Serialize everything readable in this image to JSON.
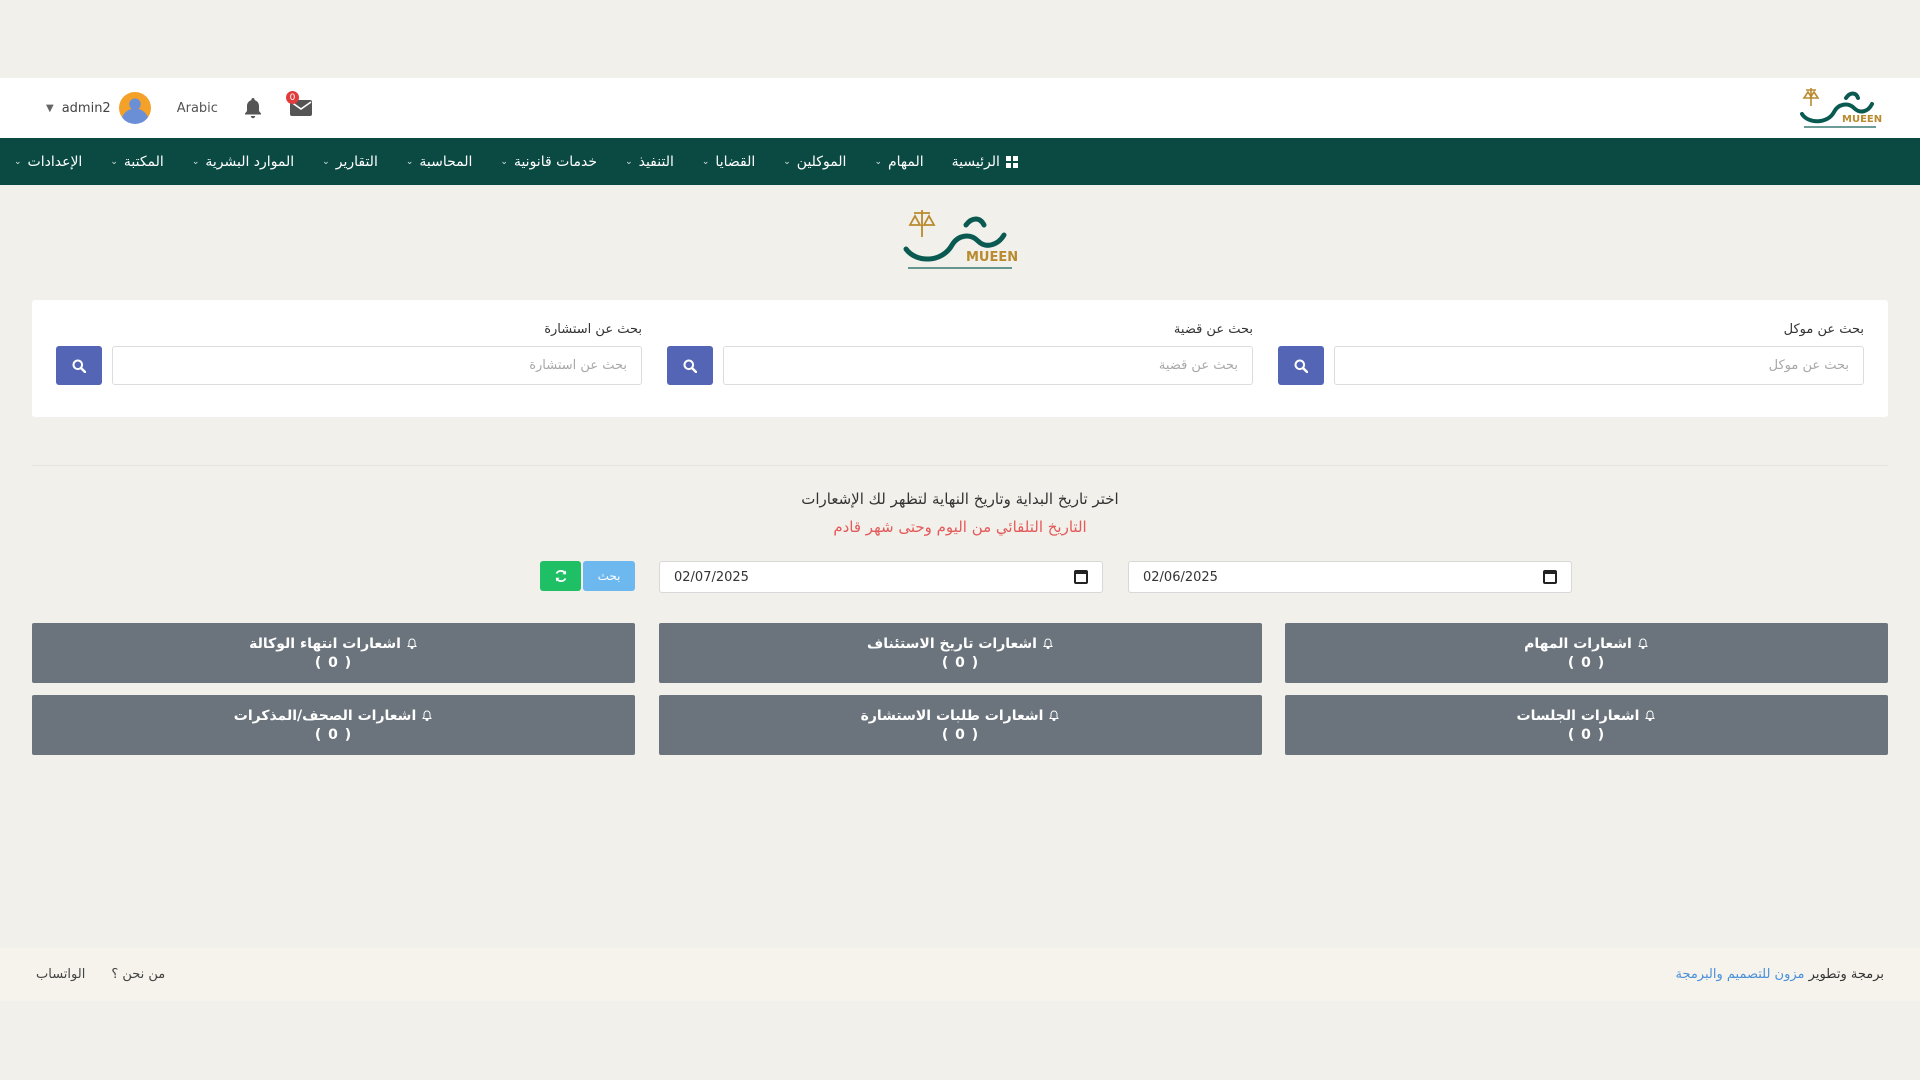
{
  "header": {
    "username": "admin2",
    "language": "Arabic",
    "mail_badge": "0",
    "logo_text": "MUEEN"
  },
  "nav": {
    "items": [
      {
        "label": "الرئيسية",
        "icon": "grid-icon",
        "dropdown": false
      },
      {
        "label": "المهام",
        "dropdown": true
      },
      {
        "label": "الموكلين",
        "dropdown": true
      },
      {
        "label": "القضايا",
        "dropdown": true
      },
      {
        "label": "التنفيذ",
        "dropdown": true
      },
      {
        "label": "خدمات قانونية",
        "dropdown": true
      },
      {
        "label": "المحاسبة",
        "dropdown": true
      },
      {
        "label": "التقارير",
        "dropdown": true
      },
      {
        "label": "الموارد البشرية",
        "dropdown": true
      },
      {
        "label": "المكتبة",
        "dropdown": true
      },
      {
        "label": "الإعدادات",
        "dropdown": true
      }
    ]
  },
  "search": {
    "client": {
      "label": "بحث عن موكل",
      "placeholder": "بحث عن موكل"
    },
    "case": {
      "label": "بحث عن قضية",
      "placeholder": "بحث عن قضية"
    },
    "consultation": {
      "label": "بحث عن استشارة",
      "placeholder": "بحث عن استشارة"
    }
  },
  "filter": {
    "title": "اختر تاريخ البداية وتاريخ النهاية لتظهر لك الإشعارات",
    "subtitle": "التاريخ التلقائي من اليوم وحتى شهر قادم",
    "start_date": "02/06/2025",
    "end_date": "02/07/2025",
    "search_label": "بحث"
  },
  "cards": [
    {
      "title": "اشعارات المهام",
      "count": "( 0 )"
    },
    {
      "title": "اشعارات تاريخ الاستئناف",
      "count": "( 0 )"
    },
    {
      "title": "اشعارات انتهاء الوكالة",
      "count": "( 0 )"
    },
    {
      "title": "اشعارات الجلسات",
      "count": "( 0 )"
    },
    {
      "title": "اشعارات طلبات الاستشارة",
      "count": "( 0 )"
    },
    {
      "title": "اشعارات الصحف/المذكرات",
      "count": "( 0 )"
    }
  ],
  "footer": {
    "credit_prefix": "برمجة وتطوير",
    "credit_link": "مزون للتصميم والبرمجة",
    "about": "من نحن ؟",
    "whatsapp": "الواتساب"
  },
  "colors": {
    "nav_bg": "#0a4a43",
    "search_btn": "#5565b6",
    "card_bg": "#6b747c",
    "hint_red": "#e45a5a",
    "refresh_green": "#1fbf66",
    "search_blue": "#6db8ee"
  }
}
